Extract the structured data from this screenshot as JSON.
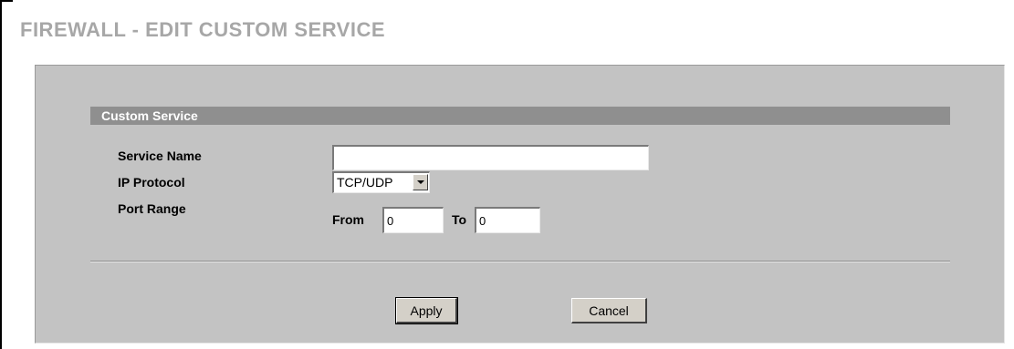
{
  "page": {
    "title": "FIREWALL - EDIT CUSTOM SERVICE"
  },
  "section": {
    "title": "Custom Service"
  },
  "form": {
    "service_name": {
      "label": "Service Name",
      "value": "",
      "placeholder": ""
    },
    "ip_protocol": {
      "label": "IP Protocol",
      "selected": "TCP/UDP"
    },
    "port_range": {
      "label": "Port Range",
      "from_label": "From",
      "from_value": "0",
      "to_label": "To",
      "to_value": "0"
    }
  },
  "buttons": {
    "apply": "Apply",
    "cancel": "Cancel"
  },
  "icons": {
    "dropdown": "chevron-down-icon"
  },
  "colors": {
    "title_text": "#a7a7a7",
    "panel_background": "#c3c3c3",
    "section_bar": "#8f8f8f",
    "section_text": "#ffffff",
    "button_face": "#d4d0c8"
  }
}
